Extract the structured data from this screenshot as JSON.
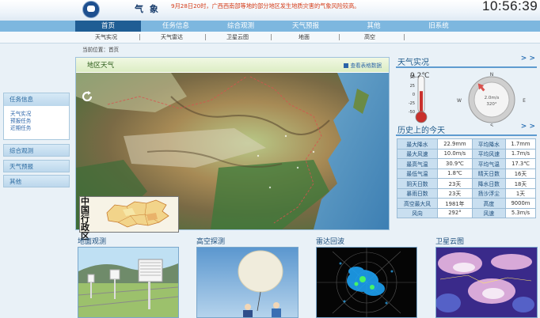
{
  "header": {
    "brand": "气 象",
    "ticker": "9月28日20时，广西西南部等地的部分地区发生地质灾害的气象风险较高。",
    "clock": "10:56:39"
  },
  "nav": {
    "items": [
      {
        "label": "首页",
        "active": true
      },
      {
        "label": "任务信息",
        "active": false
      },
      {
        "label": "综合观测",
        "active": false
      },
      {
        "label": "天气预报",
        "active": false
      },
      {
        "label": "其他",
        "active": false
      },
      {
        "label": "旧系统",
        "active": false
      }
    ]
  },
  "subnav": {
    "items": [
      "天气实况",
      "天气雷达",
      "卫星云图",
      "地面",
      "高空"
    ]
  },
  "breadcrumb": "当前位置：首页",
  "sidebar": {
    "task_box": {
      "title": "任务信息",
      "links": [
        "天气实况",
        "预报任务",
        "近期任务"
      ]
    },
    "buttons": [
      "综合观测",
      "天气预报",
      "其他"
    ]
  },
  "map": {
    "title": "地区天气",
    "table_link": "查看表格数据",
    "inset_title": "中国行政区"
  },
  "live": {
    "title": "天气实况",
    "more": "> >",
    "temperature": "9.2℃",
    "thermo_ticks": [
      "50",
      "25",
      "0",
      "-25",
      "-50"
    ],
    "temperature_value": 9.2,
    "wind_speed": "2.0m/s",
    "wind_dir": "320°",
    "wind_dir_value": 320,
    "compass": {
      "n": "N",
      "s": "S",
      "e": "E",
      "w": "W"
    }
  },
  "history": {
    "title": "历史上的今天",
    "more": "> >",
    "rows": [
      [
        "最大降水",
        "22.9mm",
        "平均降水",
        "1.7mm"
      ],
      [
        "最大风速",
        "10.0m/s",
        "平均风速",
        "1.7m/s"
      ],
      [
        "最高气温",
        "30.9℃",
        "平均气温",
        "17.3℃"
      ],
      [
        "最低气温",
        "1.8℃",
        "晴天日数",
        "16天"
      ],
      [
        "阴天日数",
        "23天",
        "降水日数",
        "18天"
      ],
      [
        "暴雨日数",
        "23天",
        "扬沙浮尘",
        "1天"
      ],
      [
        "高空最大风",
        "1981年",
        "高度",
        "9000m"
      ],
      [
        "风向",
        "292°",
        "风速",
        "5.3m/s"
      ]
    ]
  },
  "cards": [
    {
      "title": "地面观测"
    },
    {
      "title": "高空探测"
    },
    {
      "title": "雷达回波"
    },
    {
      "title": "卫星云图"
    }
  ],
  "colors": {
    "nav_bg": "#7db7df",
    "nav_active": "#1f5d94",
    "ticker": "#d43b17",
    "accent": "#1f5a8a"
  }
}
